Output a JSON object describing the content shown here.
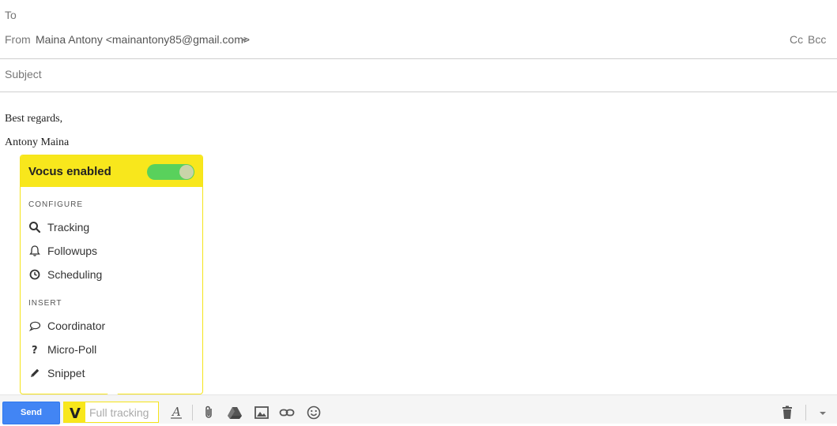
{
  "header": {
    "to_label": "To",
    "from_label": "From",
    "from_value": "Maina Antony <mainantony85@gmail.com>",
    "cc_label": "Cc",
    "bcc_label": "Bcc",
    "subject_placeholder": "Subject"
  },
  "body": {
    "line1": "Best regards,",
    "line2": "Antony Maina"
  },
  "vocus": {
    "title": "Vocus enabled",
    "enabled": true,
    "configure_heading": "CONFIGURE",
    "configure_items": [
      {
        "label": "Tracking",
        "icon": "search-icon"
      },
      {
        "label": "Followups",
        "icon": "bell-icon"
      },
      {
        "label": "Scheduling",
        "icon": "clock-icon"
      }
    ],
    "insert_heading": "INSERT",
    "insert_items": [
      {
        "label": "Coordinator",
        "icon": "speech-bubble-icon"
      },
      {
        "label": "Micro-Poll",
        "icon": "question-icon"
      },
      {
        "label": "Snippet",
        "icon": "pencil-icon"
      }
    ],
    "accent_color": "#f8e71c",
    "toggle_color": "#59d15c"
  },
  "toolbar": {
    "send_label": "Send",
    "vocus_logo": "V",
    "tracking_label": "Full tracking",
    "send_color": "#4285f4"
  }
}
